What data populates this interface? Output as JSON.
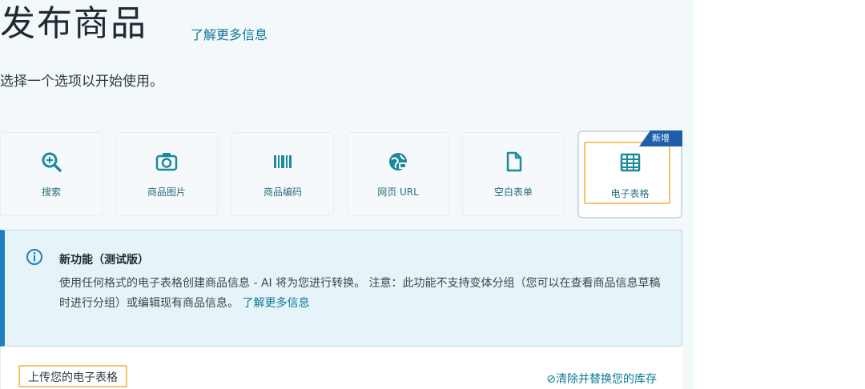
{
  "header": {
    "title": "发布商品",
    "learn_more": "了解更多信息",
    "subtitle": "选择一个选项以开始使用。"
  },
  "options": [
    {
      "label": "搜索",
      "icon": "search-icon"
    },
    {
      "label": "商品图片",
      "icon": "camera-icon"
    },
    {
      "label": "商品编码",
      "icon": "barcode-icon"
    },
    {
      "label": "网页 URL",
      "icon": "globe-icon"
    },
    {
      "label": "空白表单",
      "icon": "document-icon"
    },
    {
      "label": "电子表格",
      "icon": "spreadsheet-icon",
      "selected": true,
      "badge": "新增"
    }
  ],
  "info": {
    "title": "新功能（测试版）",
    "body": "使用任何格式的电子表格创建商品信息 - AI 将为您进行转换。 注意：此功能不支持变体分组（您可以在查看商品信息草稿时进行分组）或编辑现有商品信息。",
    "link": "了解更多信息"
  },
  "upload": {
    "label": "上传您的电子表格",
    "replace_link": "清除并替换您的库存"
  },
  "colors": {
    "accent": "#0a7a96",
    "highlight": "#f2c46b",
    "badge": "#1d5fa8"
  }
}
